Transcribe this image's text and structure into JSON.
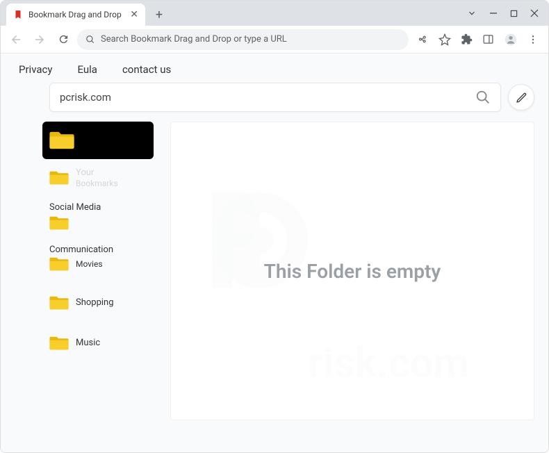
{
  "window": {
    "tab_title": "Bookmark Drag and Drop"
  },
  "toolbar": {
    "omnibox_placeholder": "Search Bookmark Drag and Drop or type a URL"
  },
  "nav": {
    "privacy": "Privacy",
    "eula": "Eula",
    "contact": "contact us"
  },
  "search": {
    "value": "pcrisk.com"
  },
  "sidebar": {
    "items": [
      {
        "label": "",
        "label2": ""
      },
      {
        "label": "Your",
        "label2": "Bookmarks"
      },
      {
        "label": "Social Media",
        "label2": ""
      },
      {
        "label": "Communication",
        "label2": "Movies"
      },
      {
        "label": "Shopping",
        "label2": ""
      },
      {
        "label": "Music",
        "label2": ""
      }
    ]
  },
  "main": {
    "empty_message": "This Folder is empty"
  }
}
